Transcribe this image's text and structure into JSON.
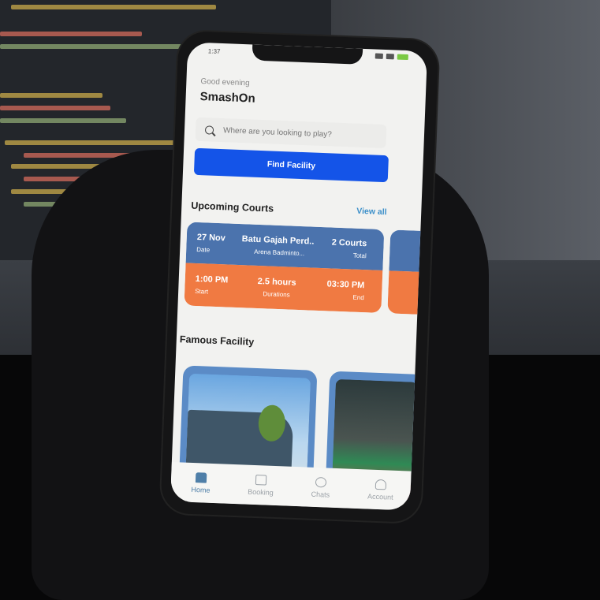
{
  "status_bar": {
    "time": "1:37"
  },
  "header": {
    "greeting": "Good evening",
    "app_name": "SmashOn"
  },
  "search": {
    "placeholder": "Where are you looking to play?"
  },
  "find_button": {
    "label": "Find Facility"
  },
  "upcoming": {
    "title": "Upcoming Courts",
    "view_all": "View all",
    "card": {
      "date_value": "27 Nov",
      "date_label": "Date",
      "venue_value": "Batu Gajah Perd..",
      "venue_sub": "Arena Badminto...",
      "courts_value": "2 Courts",
      "courts_label": "Total",
      "start_value": "1:00 PM",
      "start_label": "Start",
      "duration_value": "2.5 hours",
      "duration_label": "Durations",
      "end_value": "03:30 PM",
      "end_label": "End"
    }
  },
  "famous": {
    "title": "Famous Facility"
  },
  "nav": {
    "home": "Home",
    "booking": "Booking",
    "chats": "Chats",
    "account": "Account"
  },
  "colors": {
    "primary": "#1454e8",
    "card_top": "#4b73ad",
    "card_bottom": "#f07a42",
    "link": "#3b8fc9"
  }
}
